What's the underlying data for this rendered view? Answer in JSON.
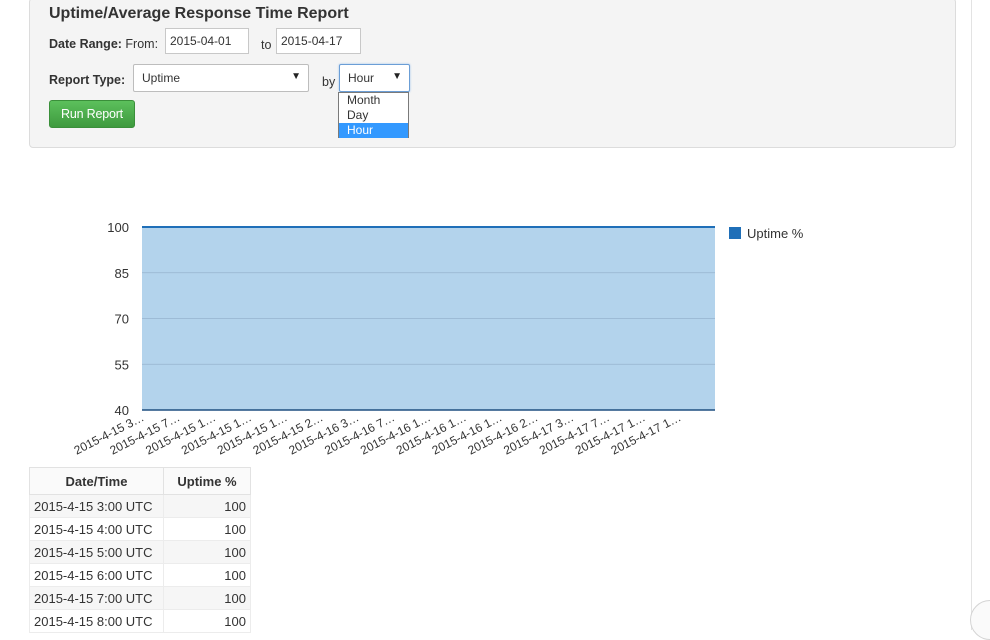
{
  "report": {
    "title": "Uptime/Average Response Time Report",
    "date_range_label": "Date Range:",
    "from_label": "From:",
    "from_value": "2015-04-01",
    "to_label": "to",
    "to_value": "2015-04-17",
    "report_type_label": "Report Type:",
    "report_type_value": "Uptime",
    "by_label": "by",
    "by_value": "Hour",
    "by_options": [
      "Month",
      "Day",
      "Hour"
    ],
    "run_button": "Run Report"
  },
  "chart_data": {
    "type": "area",
    "y_ticks": [
      100,
      85,
      70,
      55,
      40
    ],
    "ylim": [
      40,
      100
    ],
    "x_tick_labels": [
      "2015-4-15 3…",
      "2015-4-15 7…",
      "2015-4-15 1…",
      "2015-4-15 1…",
      "2015-4-15 1…",
      "2015-4-15 2…",
      "2015-4-16 3…",
      "2015-4-16 7…",
      "2015-4-16 1…",
      "2015-4-16 1…",
      "2015-4-16 1…",
      "2015-4-16 2…",
      "2015-4-17 3…",
      "2015-4-17 7…",
      "2015-4-17 1…",
      "2015-4-17 1…"
    ],
    "series": [
      {
        "name": "Uptime %",
        "color": "#1f6fb8",
        "fill": "#b3d3ec",
        "values": [
          100,
          100,
          100,
          100,
          100,
          100,
          100,
          100,
          100,
          100,
          100,
          100,
          100,
          100,
          100,
          100,
          100,
          100,
          100,
          100,
          100,
          100,
          100,
          100,
          100,
          100,
          100,
          100,
          100,
          100,
          100,
          100,
          100,
          100,
          100,
          100,
          100,
          100,
          100,
          100,
          100,
          100,
          100,
          100,
          100,
          100,
          100,
          100,
          100,
          100,
          100,
          100,
          100,
          100,
          100,
          100,
          100,
          100,
          100,
          100,
          100,
          100,
          100,
          100,
          100,
          100,
          100,
          100,
          100,
          100,
          100,
          100,
          100,
          100,
          100,
          100,
          100,
          100,
          100,
          100,
          100,
          100,
          100,
          100,
          100,
          100,
          100,
          100,
          100,
          100,
          100,
          100,
          100,
          100,
          100,
          100,
          100,
          100,
          100,
          100,
          100,
          100,
          100,
          100,
          100,
          100,
          100,
          100,
          100,
          100,
          100,
          100,
          100,
          100,
          100,
          100,
          100,
          100,
          100,
          100,
          100,
          100,
          100,
          100,
          100,
          100,
          100,
          100,
          100,
          100,
          100,
          100,
          100,
          100,
          100,
          100,
          100,
          100,
          100,
          100,
          100,
          100,
          100,
          100,
          100,
          100,
          100,
          100,
          100,
          100,
          100,
          100,
          100,
          100,
          100,
          100,
          100,
          100,
          100,
          100,
          100,
          100,
          100,
          100,
          100,
          100,
          100,
          100,
          100,
          100,
          100,
          100,
          100,
          100,
          100,
          100,
          100,
          100,
          100,
          100,
          100,
          100,
          100,
          100,
          100,
          100,
          100,
          100,
          100,
          100,
          100,
          100,
          100,
          100,
          100,
          100,
          100,
          100,
          100,
          100,
          100,
          100,
          100,
          100,
          100,
          100,
          100,
          100,
          100,
          100,
          100,
          100,
          100,
          100,
          100,
          100,
          100,
          100,
          100,
          100,
          100,
          100,
          100,
          100,
          100,
          100,
          100,
          100,
          100,
          100,
          100,
          100,
          100,
          100,
          100,
          100,
          100,
          100,
          100,
          100,
          100,
          100,
          100,
          100,
          100,
          100,
          100,
          100,
          100,
          100,
          100,
          100,
          100,
          100,
          100,
          100,
          100,
          100,
          100,
          100,
          100,
          100,
          100,
          100,
          100,
          100,
          100,
          100,
          100,
          100,
          100,
          100,
          100,
          100,
          100,
          100,
          100,
          100,
          100,
          100,
          100,
          100,
          100,
          100,
          100,
          100,
          100,
          100,
          100,
          100,
          100,
          100,
          100,
          100,
          100,
          100,
          100,
          100,
          100,
          100,
          100,
          100,
          100,
          100,
          100,
          100,
          100,
          100,
          100,
          100,
          100,
          100,
          100,
          100,
          100,
          100,
          100,
          100,
          100,
          100,
          100,
          100,
          100,
          100,
          100,
          100,
          100,
          100,
          100,
          100,
          100,
          100,
          100,
          100,
          100,
          100,
          100,
          100,
          100,
          100
        ]
      }
    ],
    "grid": true,
    "legend": "right"
  },
  "table": {
    "headers": [
      "Date/Time",
      "Uptime %"
    ],
    "rows": [
      [
        "2015-4-15 3:00 UTC",
        "100"
      ],
      [
        "2015-4-15 4:00 UTC",
        "100"
      ],
      [
        "2015-4-15 5:00 UTC",
        "100"
      ],
      [
        "2015-4-15 6:00 UTC",
        "100"
      ],
      [
        "2015-4-15 7:00 UTC",
        "100"
      ],
      [
        "2015-4-15 8:00 UTC",
        "100"
      ]
    ]
  }
}
